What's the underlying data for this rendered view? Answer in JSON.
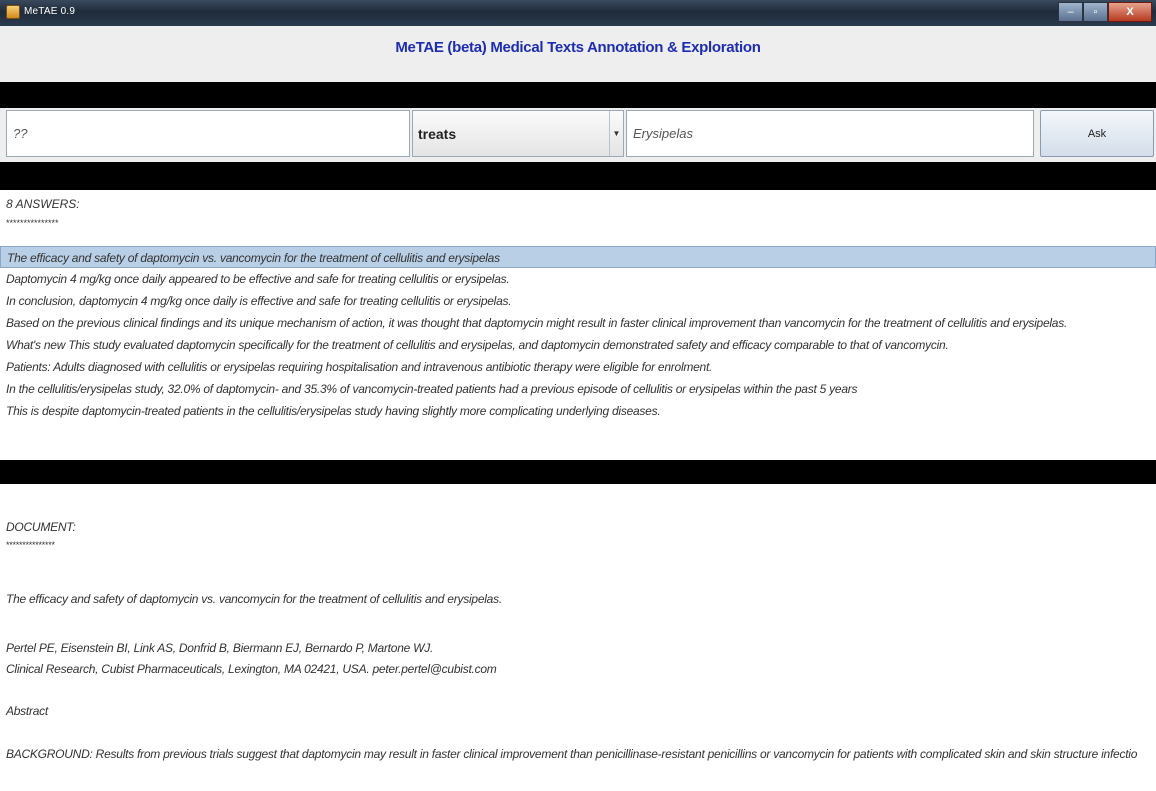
{
  "window": {
    "title": "MeTAE 0.9",
    "controls": {
      "minimize": "–",
      "maximize": "▫",
      "close": "X"
    }
  },
  "header": {
    "title": "MeTAE (beta) Medical Texts Annotation & Exploration"
  },
  "query": {
    "subject": "??",
    "relation": "treats",
    "object": "Erysipelas",
    "ask_label": "Ask"
  },
  "answers": {
    "count_label": "8 ANSWERS:",
    "separator": "***************",
    "selected_index": 0,
    "items": [
      "The efficacy and safety of daptomycin vs. vancomycin for the treatment of cellulitis and erysipelas",
      "Daptomycin 4 mg/kg once daily appeared to be effective and safe for treating cellulitis or erysipelas.",
      "In conclusion, daptomycin 4 mg/kg once daily is effective and safe for treating cellulitis or erysipelas.",
      "Based on the previous clinical findings and its unique mechanism of action, it was thought that daptomycin might result in faster clinical improvement than vancomycin for the treatment of cellulitis and erysipelas.",
      "What's new This study evaluated daptomycin specifically for the treatment of cellulitis and erysipelas, and daptomycin demonstrated safety and efficacy comparable to that of vancomycin.",
      "Patients: Adults diagnosed with cellulitis or erysipelas requiring hospitalisation and intravenous antibiotic therapy were eligible for enrolment.",
      "In the cellulitis/erysipelas study, 32.0% of daptomycin- and 35.3% of vancomycin-treated patients had a previous episode of cellulitis or erysipelas within the past 5 years",
      "This is despite daptomycin-treated patients in the cellulitis/erysipelas study having slightly more complicating underlying diseases."
    ]
  },
  "document": {
    "label": "DOCUMENT:",
    "separator": "***************",
    "title": "The efficacy and safety of daptomycin vs. vancomycin for the treatment of cellulitis and erysipelas.",
    "authors": "Pertel PE, Eisenstein BI, Link AS, Donfrid B, Biermann EJ, Bernardo P, Martone WJ.",
    "affiliation": "Clinical Research, Cubist Pharmaceuticals, Lexington, MA 02421, USA. peter.pertel@cubist.com",
    "abstract_heading": "Abstract",
    "background": "BACKGROUND: Results from previous trials suggest that daptomycin may result in faster clinical improvement than penicillinase-resistant penicillins or vancomycin for patients with complicated skin and skin structure infectio"
  }
}
